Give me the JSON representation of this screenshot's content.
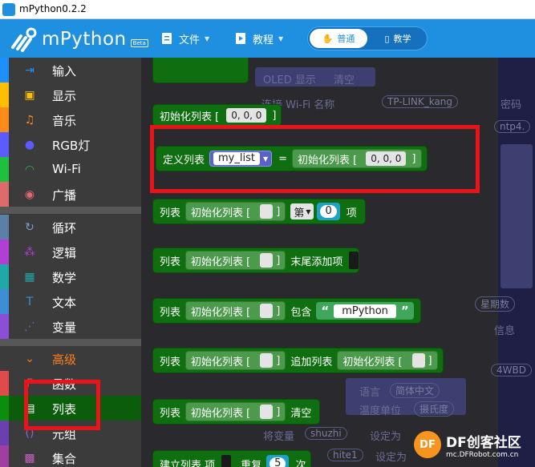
{
  "window": {
    "title": "mPython0.2.2"
  },
  "toolbar": {
    "logo_text": "mPython",
    "logo_badge": "Beta",
    "file_label": "文件",
    "tutorial_label": "教程",
    "mode_normal": "普通",
    "mode_pro": "教学"
  },
  "sidebar": {
    "items": [
      {
        "label": "输入",
        "icon": "input-icon",
        "color": "#1e8fff"
      },
      {
        "label": "显示",
        "icon": "display-icon",
        "color": "#ffbf00"
      },
      {
        "label": "音乐",
        "icon": "music-icon",
        "color": "#ff8c1a"
      },
      {
        "label": "RGB灯",
        "icon": "rgb-led-icon",
        "color": "#5b5bff"
      },
      {
        "label": "Wi-Fi",
        "icon": "wifi-icon",
        "color": "#1fbf3f"
      },
      {
        "label": "广播",
        "icon": "broadcast-icon",
        "color": "#e06a6a"
      },
      {
        "label": "循环",
        "icon": "loop-icon",
        "color": "#5b80a5"
      },
      {
        "label": "逻辑",
        "icon": "logic-icon",
        "color": "#b13fd6"
      },
      {
        "label": "数学",
        "icon": "math-icon",
        "color": "#20a8a8"
      },
      {
        "label": "文本",
        "icon": "text-icon",
        "color": "#3d8ed6"
      },
      {
        "label": "变量",
        "icon": "variable-icon",
        "color": "#8a4fd6"
      },
      {
        "label": "高级",
        "icon": "chevron-down-icon",
        "color": "#ff7d1a"
      },
      {
        "label": "函数",
        "icon": "function-icon",
        "color": "#e04a4a"
      },
      {
        "label": "列表",
        "icon": "list-icon",
        "color": "#0b8f0b"
      },
      {
        "label": "元组",
        "icon": "tuple-icon",
        "color": "#6b3fb0"
      },
      {
        "label": "集合",
        "icon": "set-icon",
        "color": "#a03fa0"
      }
    ]
  },
  "blocks": {
    "init_list_label": "初始化列表 [",
    "init_list_values": "0, 0, 0",
    "close_bracket": "]",
    "define_list_label": "定义列表",
    "var_name": "my_list",
    "equals": "=",
    "list_label": "列表",
    "index_label": "第",
    "index_value": "0",
    "item_label": "项",
    "append_label": "末尾添加项",
    "contains_label": "包含",
    "contains_value": "mPython",
    "extend_label": "追加列表",
    "clear_label": "清空",
    "build_list_label": "建立列表 项",
    "repeat_label": "重复",
    "repeat_value": "5",
    "times_label": "次"
  },
  "background_code": {
    "oled_label": "OLED 显示",
    "oled_clear": "清空",
    "wifi_label": "连接 Wi-Fi 名称",
    "wifi_value": "TP-LINK_kang",
    "password_label": "密码",
    "ntp_value": "ntp4.",
    "weekday_value": "星期数",
    "info_label": "信息",
    "city_code": "4WBD",
    "language_label": "语言",
    "language_value": "简体中文",
    "temp_unit_label": "温度单位",
    "temp_unit_value": "摄氏度",
    "assign_label": "将变量",
    "assign_var": "shuzhi",
    "assign_to": "设定为",
    "white1_value": "hite1"
  },
  "watermark": {
    "main": "DF创客社区",
    "sub": "mc.DFRobot.com.cn"
  }
}
